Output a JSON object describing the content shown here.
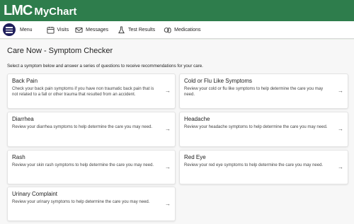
{
  "brand": {
    "mark": "LMC",
    "product": "MyChart"
  },
  "nav": {
    "menu_label": "Menu",
    "items": [
      {
        "label": "Visits",
        "icon": "calendar-icon"
      },
      {
        "label": "Messages",
        "icon": "envelope-icon"
      },
      {
        "label": "Test Results",
        "icon": "flask-icon"
      },
      {
        "label": "Medications",
        "icon": "pills-icon"
      }
    ]
  },
  "page": {
    "title": "Care Now - Symptom Checker",
    "intro": "Select a symptom below and answer a series of questions to receive recommendations for your care."
  },
  "symptoms": [
    {
      "title": "Back Pain",
      "desc": "Check your back pain symptoms if you have non traumatic back pain that is not related to a fall or other trauma that resulted from an accident."
    },
    {
      "title": "Cold or Flu Like Symptoms",
      "desc": "Review your cold or flu like symptoms to help determine the care you may need."
    },
    {
      "title": "Diarrhea",
      "desc": "Review your diarrhea symptoms to help determine the care you may need."
    },
    {
      "title": "Headache",
      "desc": "Review your headache symptoms to help determine the care you may need."
    },
    {
      "title": "Rash",
      "desc": "Review your skin rash symptoms to help determine the care you may need."
    },
    {
      "title": "Red Eye",
      "desc": "Review your red eye symptoms to help determine the care you may need."
    },
    {
      "title": "Urinary Complaint",
      "desc": "Review your urinary symptoms to help determine the care you may need."
    }
  ],
  "arrow_glyph": "→",
  "colors": {
    "header": "#2e7d4c",
    "menu_button": "#1f1f5b"
  }
}
